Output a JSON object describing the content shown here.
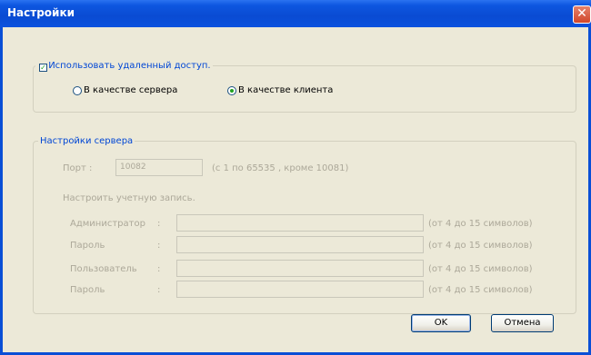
{
  "window": {
    "title": "Настройки",
    "close_glyph": "✕"
  },
  "remote": {
    "checkbox_label": "Использовать удаленный доступ.",
    "checked": true,
    "server_label": "В качестве сервера",
    "client_label": "В качестве клиента",
    "selected": "client"
  },
  "server": {
    "legend": "Настройки сервера",
    "port_label": "Порт :",
    "port_value": "10082",
    "port_hint": "(с 1 по 65535 , кроме 10081)",
    "account_label": "Настроить учетную запись.",
    "colon": ":",
    "rows": [
      {
        "label": "Администратор",
        "value": "",
        "hint": "(от 4 до 15 символов)"
      },
      {
        "label": "Пароль",
        "value": "",
        "hint": "(от 4 до 15 символов)"
      },
      {
        "label": "Пользователь",
        "value": "",
        "hint": "(от 4 до 15 символов)"
      },
      {
        "label": "Пароль",
        "value": "",
        "hint": "(от 4 до 15 символов)"
      }
    ]
  },
  "buttons": {
    "ok": "OK",
    "cancel": "Отмена"
  },
  "colors": {
    "titlebar": "#0a4bd2",
    "face": "#ece9d8",
    "legend": "#0046d5",
    "disabled": "#aca899",
    "check": "#21a121"
  }
}
